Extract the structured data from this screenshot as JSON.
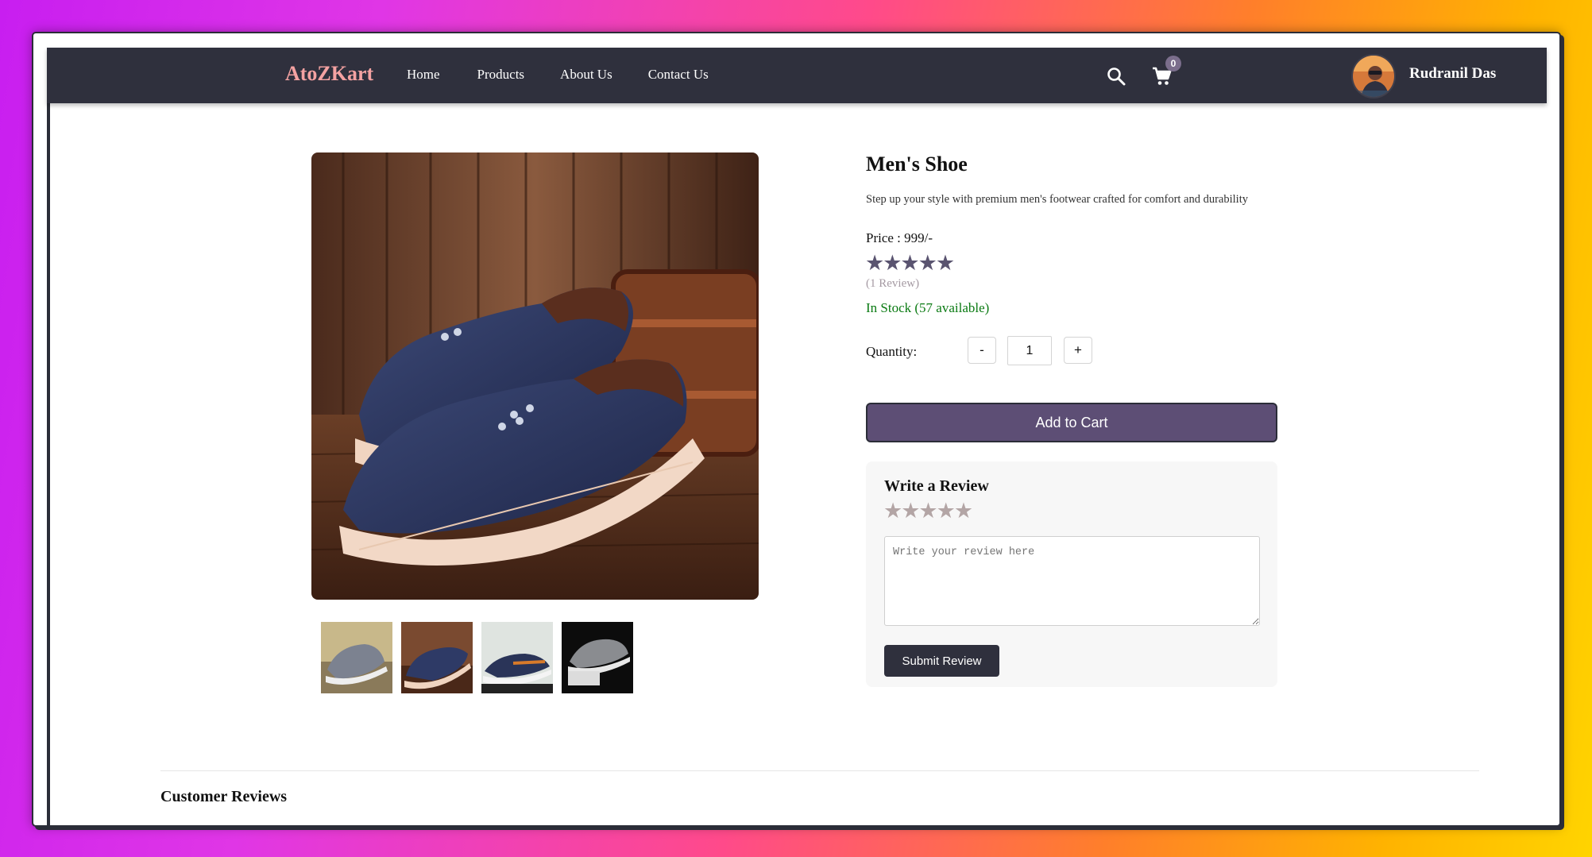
{
  "navbar": {
    "logo": "AtoZKart",
    "links": [
      "Home",
      "Products",
      "About Us",
      "Contact Us"
    ],
    "cart_count": "0",
    "username": "Rudranil Das"
  },
  "product": {
    "title": "Men's Shoe",
    "description": "Step up your style with premium men's footwear crafted for comfort and durability",
    "price": "Price : 999/-",
    "stars": "★★★★★",
    "review_count": "(1 Review)",
    "stock": "In Stock (57 available)",
    "quantity_label": "Quantity:",
    "quantity_value": "1",
    "minus": "-",
    "plus": "+",
    "add_to_cart": "Add to Cart"
  },
  "review_form": {
    "title": "Write a Review",
    "stars": "★★★★★",
    "placeholder": "Write your review here",
    "submit": "Submit Review"
  },
  "customer_reviews": {
    "heading": "Customer Reviews"
  },
  "colors": {
    "navbar": "#2f303d",
    "logo": "#f4a2a2",
    "accent": "#5d4e75",
    "in_stock": "#0a7a12"
  }
}
